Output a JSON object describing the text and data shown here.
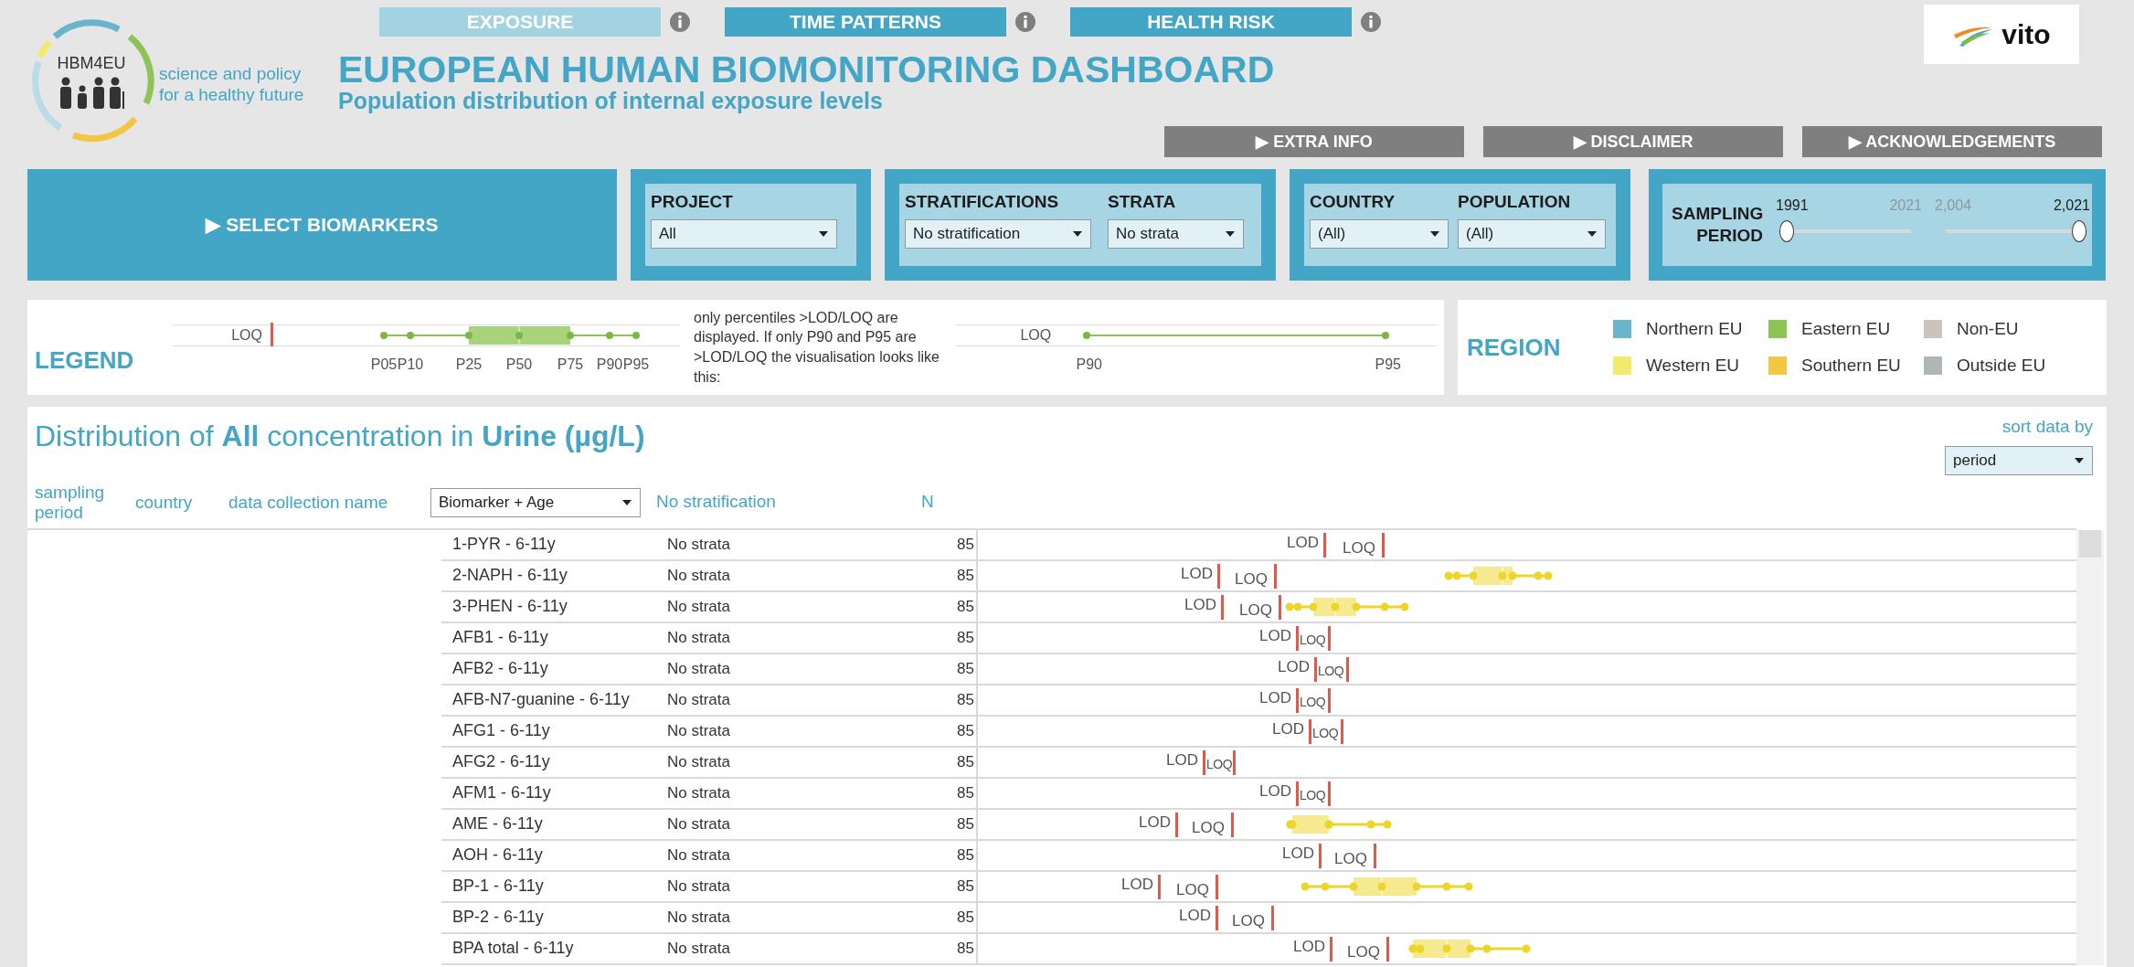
{
  "nav_tabs": [
    {
      "label": "EXPOSURE",
      "selected": true
    },
    {
      "label": "TIME PATTERNS",
      "selected": false
    },
    {
      "label": "HEALTH RISK",
      "selected": false
    }
  ],
  "logo": {
    "name": "HBM4EU",
    "tagline": "science and policy for a healthy future"
  },
  "title": "EUROPEAN HUMAN BIOMONITORING DASHBOARD",
  "subtitle": "Population distribution of internal exposure levels",
  "partner_logo": {
    "name": "vito"
  },
  "link_buttons": [
    "▶ EXTRA INFO",
    "▶ DISCLAIMER",
    "▶ ACKNOWLEDGEMENTS"
  ],
  "filters": {
    "select_biomarkers": "▶ SELECT BIOMARKERS",
    "groups": [
      {
        "fields": [
          {
            "label": "PROJECT",
            "value": "All"
          }
        ]
      },
      {
        "fields": [
          {
            "label": "STRATIFICATIONS",
            "value": "No stratification"
          },
          {
            "label": "STRATA",
            "value": "No strata"
          }
        ]
      },
      {
        "fields": [
          {
            "label": "COUNTRY",
            "value": "(All)"
          },
          {
            "label": "POPULATION",
            "value": "(All)"
          }
        ]
      }
    ],
    "sampling_period": {
      "label": "SAMPLING PERIOD",
      "sliders": [
        {
          "min_label": "1991",
          "max_label": "2021"
        },
        {
          "min_label": "2,004",
          "max_label": "2,021"
        }
      ]
    }
  },
  "legend": {
    "title": "LEGEND",
    "loq_label": "LOQ",
    "percentiles": [
      "P05",
      "P10",
      "P25",
      "P50",
      "P75",
      "P90",
      "P95"
    ],
    "note": "only percentiles >LOD/LOQ are displayed. If only P90 and P95 are >LOD/LOQ the visualisation looks like this:",
    "example": {
      "loq_label": "LOQ",
      "percentiles": [
        "P90",
        "P95"
      ]
    }
  },
  "region": {
    "title": "REGION",
    "items": [
      {
        "label": "Northern EU",
        "color": "#6ab4cc"
      },
      {
        "label": "Eastern EU",
        "color": "#8dc455"
      },
      {
        "label": "Non-EU",
        "color": "#cdc3be"
      },
      {
        "label": "Western EU",
        "color": "#f3e96b"
      },
      {
        "label": "Southern EU",
        "color": "#f2c744"
      },
      {
        "label": "Outside EU",
        "color": "#b0b5b5"
      }
    ]
  },
  "distribution": {
    "title": "Distribution of **All** concentration in **Urine** **(µg/L)**",
    "sort": {
      "label": "sort data by",
      "value": "period"
    },
    "columns": [
      "sampling period",
      "country",
      "data collection name"
    ],
    "row_select": "Biomarker + Age",
    "strat_header": "No stratification",
    "n_header": "N",
    "rows": [
      {
        "biomarker": "1-PYR - 6-11y",
        "strata": "No strata",
        "n": "85",
        "lod_label": "LOD",
        "loq_label": "LOQ"
      },
      {
        "biomarker": "2-NAPH - 6-11y",
        "strata": "No strata",
        "n": "85",
        "lod_label": "LOD",
        "loq_label": "LOQ"
      },
      {
        "biomarker": "3-PHEN - 6-11y",
        "strata": "No strata",
        "n": "85",
        "lod_label": "LOD",
        "loq_label": "LOQ"
      },
      {
        "biomarker": "AFB1 - 6-11y",
        "strata": "No strata",
        "n": "85",
        "lod_label": "LOD",
        "loq_label": "LOQ"
      },
      {
        "biomarker": "AFB2 - 6-11y",
        "strata": "No strata",
        "n": "85",
        "lod_label": "LOD",
        "loq_label": "LOQ"
      },
      {
        "biomarker": "AFB-N7-guanine - 6-11y",
        "strata": "No strata",
        "n": "85",
        "lod_label": "LOD",
        "loq_label": "LOQ"
      },
      {
        "biomarker": "AFG1 - 6-11y",
        "strata": "No strata",
        "n": "85",
        "lod_label": "LOD",
        "loq_label": "LOQ"
      },
      {
        "biomarker": "AFG2 - 6-11y",
        "strata": "No strata",
        "n": "85",
        "lod_label": "LOD",
        "loq_label": "LOQ"
      },
      {
        "biomarker": "AFM1 - 6-11y",
        "strata": "No strata",
        "n": "85",
        "lod_label": "LOD",
        "loq_label": "LOQ"
      },
      {
        "biomarker": "AME - 6-11y",
        "strata": "No strata",
        "n": "85",
        "lod_label": "LOD",
        "loq_label": "LOQ"
      },
      {
        "biomarker": "AOH - 6-11y",
        "strata": "No strata",
        "n": "85",
        "lod_label": "LOD",
        "loq_label": "LOQ"
      },
      {
        "biomarker": "BP-1 - 6-11y",
        "strata": "No strata",
        "n": "85",
        "lod_label": "LOD",
        "loq_label": "LOQ"
      },
      {
        "biomarker": "BP-2 - 6-11y",
        "strata": "No strata",
        "n": "85",
        "lod_label": "LOD",
        "loq_label": "LOQ"
      },
      {
        "biomarker": "BPA total - 6-11y",
        "strata": "No strata",
        "n": "85",
        "lod_label": "LOD",
        "loq_label": "LOQ"
      }
    ]
  }
}
